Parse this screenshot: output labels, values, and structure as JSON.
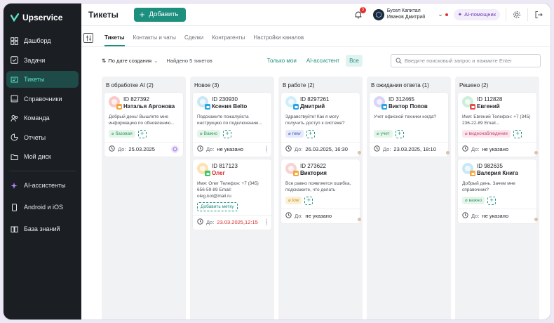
{
  "brand": {
    "name": "Upservice"
  },
  "sidebar": {
    "items": [
      {
        "label": "Дашборд",
        "icon": "dashboard-icon",
        "active": false
      },
      {
        "label": "Задачи",
        "icon": "tasks-icon",
        "active": false
      },
      {
        "label": "Тикеты",
        "icon": "tickets-icon",
        "active": true
      },
      {
        "label": "Справочники",
        "icon": "book-icon",
        "active": false
      },
      {
        "label": "Команда",
        "icon": "team-icon",
        "active": false
      },
      {
        "label": "Отчеты",
        "icon": "reports-icon",
        "active": false
      },
      {
        "label": "Мой диск",
        "icon": "folder-icon",
        "active": false
      }
    ],
    "items2": [
      {
        "label": "AI-ассистенты",
        "icon": "sparkle-icon"
      },
      {
        "label": "Android и iOS",
        "icon": "phone-icon"
      },
      {
        "label": "База знаний",
        "icon": "knowledge-icon"
      }
    ]
  },
  "header": {
    "title": "Тикеты",
    "add_label": "Добавить",
    "notifications": "3",
    "company_name": "Бусел Капитал",
    "user_name": "Иванов Дмитрий",
    "ai_label": "AI-помощник"
  },
  "tabs": [
    "Тикеты",
    "Контакты и чаты",
    "Сделки",
    "Контрагенты",
    "Настройки каналов"
  ],
  "toolbar": {
    "sort_label": "По дате создания",
    "found_label": "Найдено 5 тикетов",
    "segments": [
      "Только мои",
      "AI-ассистент",
      "Все"
    ],
    "search_placeholder": "Введите поисковый запрос и нажмите Enter"
  },
  "columns": [
    {
      "title": "В обработке AI (2)",
      "cards": [
        {
          "id": "ID 827392",
          "name": "Наталья Аргонова",
          "msg": "Добрый день! Вышлете мне информацию по обновлению...",
          "tag": "базовая",
          "tag_color": "green",
          "due_label": "До:",
          "due": "25.03.2025",
          "assignee": "bot"
        }
      ]
    },
    {
      "title": "Новое (3)",
      "cards": [
        {
          "id": "ID 230930",
          "name": "Ксения Belto",
          "msg": "Подскажите пожалуйста инструкцию по подключению...",
          "tag": "Важно",
          "tag_color": "green",
          "due_label": "До:",
          "due": "не указано",
          "assignee": "empty"
        },
        {
          "id": "ID 817123",
          "name": "Олег",
          "name_red": true,
          "msg": "Имя: Олег Телефон: +7 (345) 656-59-89 Email: oleg.kot@mail.ru",
          "tag": "Добавить метку",
          "tag_color": "dashed",
          "due_label": "До:",
          "due": "23.03.2025,12:15",
          "due_red": true,
          "assignee": "empty"
        }
      ]
    },
    {
      "title": "В работе (2)",
      "cards": [
        {
          "id": "ID 8297261",
          "name": "Дмитрий",
          "msg": "Здравствуйте! Как я могу получить доступ к системе?",
          "tag": "new",
          "tag_color": "blue",
          "due_label": "До:",
          "due": "26.03.2025, 16:30",
          "assignee": "agent"
        },
        {
          "id": "ID 273622",
          "name": "Виктория",
          "msg": "Все равно появляется ошибка, подскажите, что делать",
          "tag": "low",
          "tag_color": "yellow",
          "due_label": "До:",
          "due": "не указано",
          "assignee": "agent"
        }
      ]
    },
    {
      "title": "В ожидании ответа (1)",
      "cards": [
        {
          "id": "ID 312465",
          "name": "Виктор Попов",
          "msg": "Учет офисной техники когда?",
          "tag": "учет",
          "tag_color": "green",
          "due_label": "До:",
          "due": "23.03.2025, 18:10",
          "assignee": "agent"
        }
      ]
    },
    {
      "title": "Решено (2)",
      "cards": [
        {
          "id": "ID 112828",
          "name": "Евгений",
          "msg": "Имя: Евгений Телефон: +7 (345) 236-22-89 Email...",
          "tag": "видеонаблюдение",
          "tag_color": "pink",
          "due_label": "До:",
          "due": "не указано",
          "assignee": "agent"
        },
        {
          "id": "ID 982635",
          "name": "Валерия Книга",
          "msg": "Добрый день. Зачем мне справочник?",
          "tag": "важно",
          "tag_color": "green",
          "due_label": "До:",
          "due": "не указано",
          "assignee": "agent"
        }
      ]
    }
  ],
  "colors": {
    "accent": "#1c8f7f",
    "sidebar_bg": "#1b1f24",
    "active_nav": "#5de2c8",
    "danger": "#d62b2b"
  }
}
